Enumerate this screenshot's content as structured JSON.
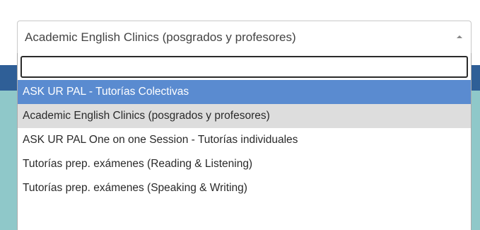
{
  "select": {
    "value": "Academic English Clinics (posgrados y profesores)",
    "arrow_icon": "chevron-up-icon"
  },
  "search": {
    "value": "",
    "placeholder": ""
  },
  "options": [
    {
      "label": "ASK UR PAL - Tutorías Colectivas",
      "state": "highlighted"
    },
    {
      "label": "Academic English Clinics (posgrados y profesores)",
      "state": "selected"
    },
    {
      "label": "ASK UR PAL One on one Session - Tutorías individuales",
      "state": "normal"
    },
    {
      "label": "Tutorías prep. exámenes (Reading & Listening)",
      "state": "normal"
    },
    {
      "label": "Tutorías prep. exámenes (Speaking & Writing)",
      "state": "normal"
    }
  ],
  "colors": {
    "highlight": "#5a8bd0",
    "selected": "#dddddd",
    "header_band": "#2f5f97",
    "teal_band": "#8fc8c9"
  }
}
